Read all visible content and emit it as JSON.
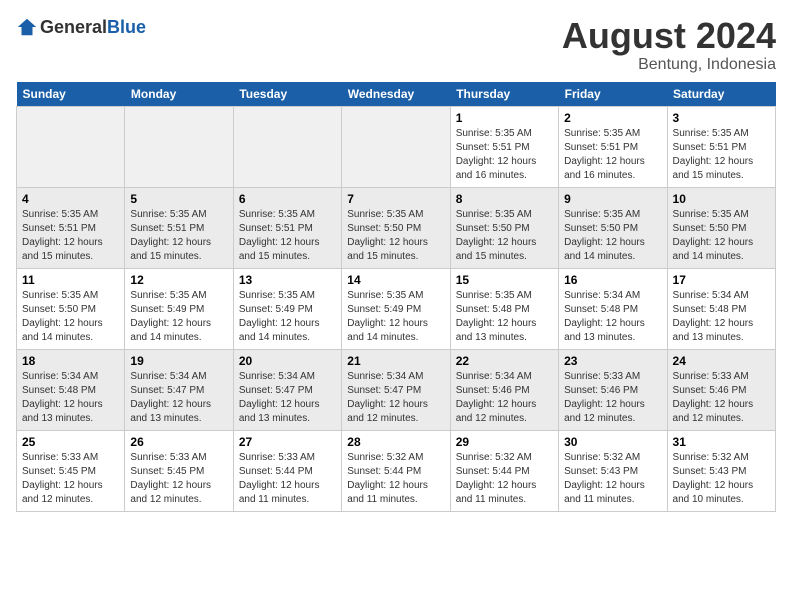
{
  "logo": {
    "text_general": "General",
    "text_blue": "Blue"
  },
  "header": {
    "month_year": "August 2024",
    "location": "Bentung, Indonesia"
  },
  "weekdays": [
    "Sunday",
    "Monday",
    "Tuesday",
    "Wednesday",
    "Thursday",
    "Friday",
    "Saturday"
  ],
  "weeks": [
    [
      {
        "day": "",
        "info": ""
      },
      {
        "day": "",
        "info": ""
      },
      {
        "day": "",
        "info": ""
      },
      {
        "day": "",
        "info": ""
      },
      {
        "day": "1",
        "info": "Sunrise: 5:35 AM\nSunset: 5:51 PM\nDaylight: 12 hours and 16 minutes."
      },
      {
        "day": "2",
        "info": "Sunrise: 5:35 AM\nSunset: 5:51 PM\nDaylight: 12 hours and 16 minutes."
      },
      {
        "day": "3",
        "info": "Sunrise: 5:35 AM\nSunset: 5:51 PM\nDaylight: 12 hours and 15 minutes."
      }
    ],
    [
      {
        "day": "4",
        "info": "Sunrise: 5:35 AM\nSunset: 5:51 PM\nDaylight: 12 hours and 15 minutes."
      },
      {
        "day": "5",
        "info": "Sunrise: 5:35 AM\nSunset: 5:51 PM\nDaylight: 12 hours and 15 minutes."
      },
      {
        "day": "6",
        "info": "Sunrise: 5:35 AM\nSunset: 5:51 PM\nDaylight: 12 hours and 15 minutes."
      },
      {
        "day": "7",
        "info": "Sunrise: 5:35 AM\nSunset: 5:50 PM\nDaylight: 12 hours and 15 minutes."
      },
      {
        "day": "8",
        "info": "Sunrise: 5:35 AM\nSunset: 5:50 PM\nDaylight: 12 hours and 15 minutes."
      },
      {
        "day": "9",
        "info": "Sunrise: 5:35 AM\nSunset: 5:50 PM\nDaylight: 12 hours and 14 minutes."
      },
      {
        "day": "10",
        "info": "Sunrise: 5:35 AM\nSunset: 5:50 PM\nDaylight: 12 hours and 14 minutes."
      }
    ],
    [
      {
        "day": "11",
        "info": "Sunrise: 5:35 AM\nSunset: 5:50 PM\nDaylight: 12 hours and 14 minutes."
      },
      {
        "day": "12",
        "info": "Sunrise: 5:35 AM\nSunset: 5:49 PM\nDaylight: 12 hours and 14 minutes."
      },
      {
        "day": "13",
        "info": "Sunrise: 5:35 AM\nSunset: 5:49 PM\nDaylight: 12 hours and 14 minutes."
      },
      {
        "day": "14",
        "info": "Sunrise: 5:35 AM\nSunset: 5:49 PM\nDaylight: 12 hours and 14 minutes."
      },
      {
        "day": "15",
        "info": "Sunrise: 5:35 AM\nSunset: 5:48 PM\nDaylight: 12 hours and 13 minutes."
      },
      {
        "day": "16",
        "info": "Sunrise: 5:34 AM\nSunset: 5:48 PM\nDaylight: 12 hours and 13 minutes."
      },
      {
        "day": "17",
        "info": "Sunrise: 5:34 AM\nSunset: 5:48 PM\nDaylight: 12 hours and 13 minutes."
      }
    ],
    [
      {
        "day": "18",
        "info": "Sunrise: 5:34 AM\nSunset: 5:48 PM\nDaylight: 12 hours and 13 minutes."
      },
      {
        "day": "19",
        "info": "Sunrise: 5:34 AM\nSunset: 5:47 PM\nDaylight: 12 hours and 13 minutes."
      },
      {
        "day": "20",
        "info": "Sunrise: 5:34 AM\nSunset: 5:47 PM\nDaylight: 12 hours and 13 minutes."
      },
      {
        "day": "21",
        "info": "Sunrise: 5:34 AM\nSunset: 5:47 PM\nDaylight: 12 hours and 12 minutes."
      },
      {
        "day": "22",
        "info": "Sunrise: 5:34 AM\nSunset: 5:46 PM\nDaylight: 12 hours and 12 minutes."
      },
      {
        "day": "23",
        "info": "Sunrise: 5:33 AM\nSunset: 5:46 PM\nDaylight: 12 hours and 12 minutes."
      },
      {
        "day": "24",
        "info": "Sunrise: 5:33 AM\nSunset: 5:46 PM\nDaylight: 12 hours and 12 minutes."
      }
    ],
    [
      {
        "day": "25",
        "info": "Sunrise: 5:33 AM\nSunset: 5:45 PM\nDaylight: 12 hours and 12 minutes."
      },
      {
        "day": "26",
        "info": "Sunrise: 5:33 AM\nSunset: 5:45 PM\nDaylight: 12 hours and 12 minutes."
      },
      {
        "day": "27",
        "info": "Sunrise: 5:33 AM\nSunset: 5:44 PM\nDaylight: 12 hours and 11 minutes."
      },
      {
        "day": "28",
        "info": "Sunrise: 5:32 AM\nSunset: 5:44 PM\nDaylight: 12 hours and 11 minutes."
      },
      {
        "day": "29",
        "info": "Sunrise: 5:32 AM\nSunset: 5:44 PM\nDaylight: 12 hours and 11 minutes."
      },
      {
        "day": "30",
        "info": "Sunrise: 5:32 AM\nSunset: 5:43 PM\nDaylight: 12 hours and 11 minutes."
      },
      {
        "day": "31",
        "info": "Sunrise: 5:32 AM\nSunset: 5:43 PM\nDaylight: 12 hours and 10 minutes."
      }
    ]
  ]
}
